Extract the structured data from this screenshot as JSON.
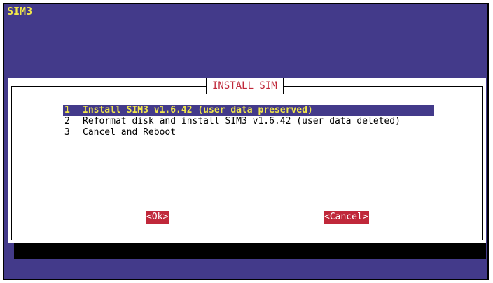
{
  "app": {
    "title": "SIM3"
  },
  "dialog": {
    "title": "INSTALL SIM",
    "items": [
      {
        "num": "1",
        "label": "Install SIM3 v1.6.42 (user data preserved)",
        "selected": true
      },
      {
        "num": "2",
        "label": "Reformat disk and install SIM3 v1.6.42 (user data deleted)",
        "selected": false
      },
      {
        "num": "3",
        "label": "Cancel and Reboot",
        "selected": false
      }
    ],
    "buttons": {
      "ok": "<Ok>",
      "cancel": "<Cancel>"
    }
  },
  "colors": {
    "background": "#433a8a",
    "title_text": "#f2e84a",
    "accent_red": "#c0283a",
    "dialog_bg": "#ffffff"
  }
}
